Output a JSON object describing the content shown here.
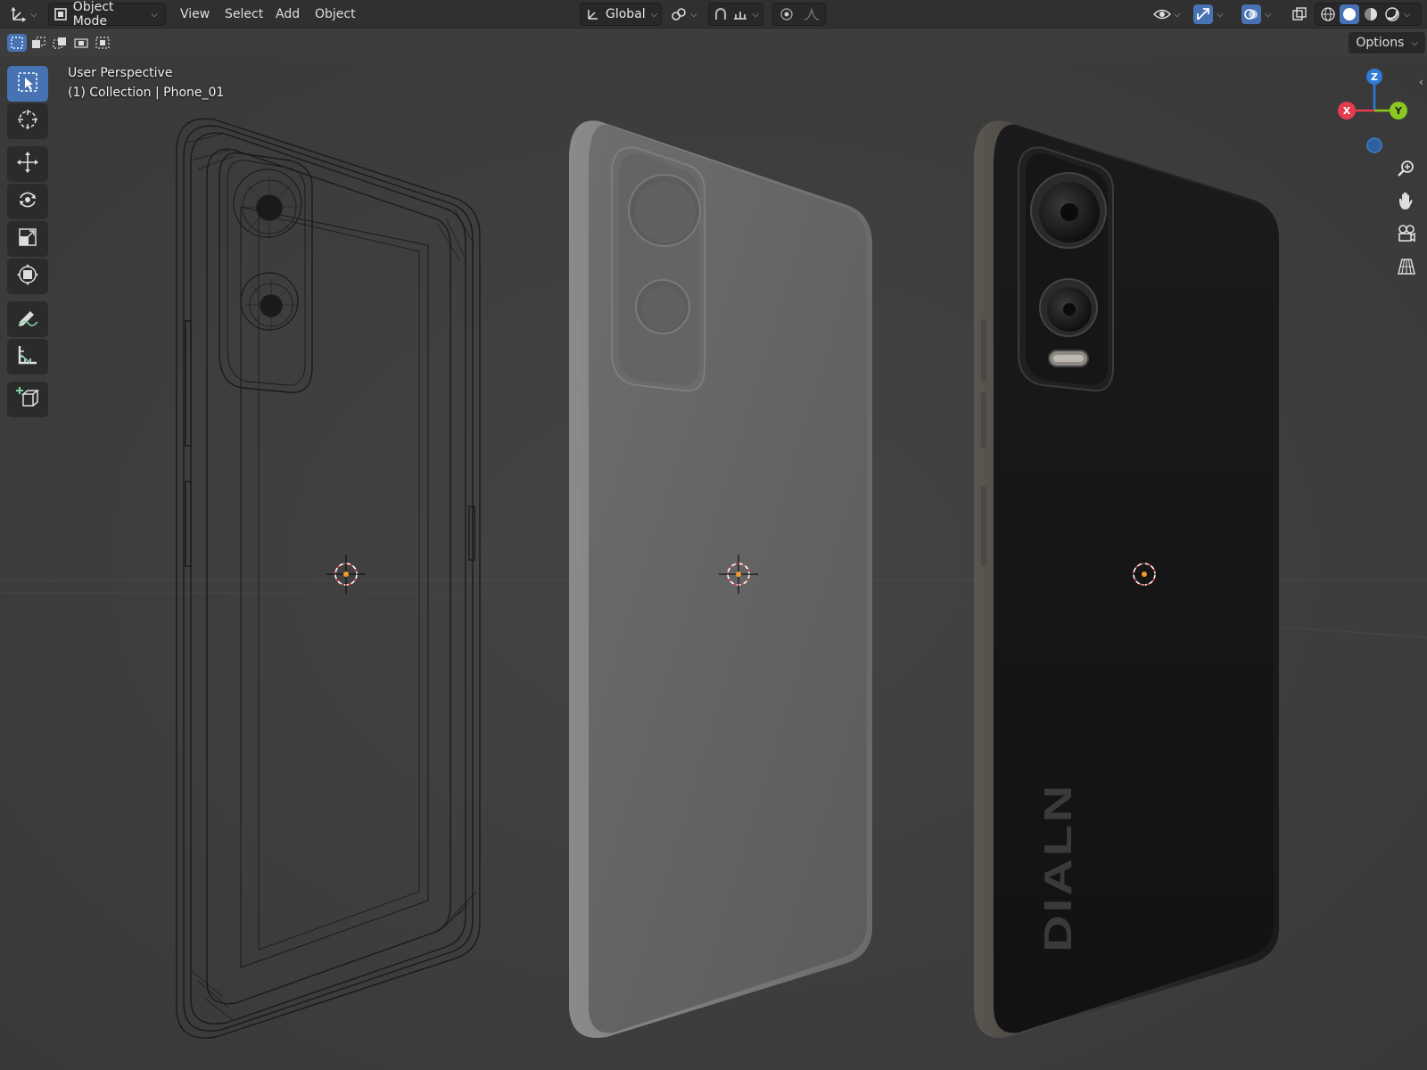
{
  "header": {
    "editor_icon": "grid-axes-icon",
    "mode_label": "Object Mode",
    "menus": [
      "View",
      "Select",
      "Add",
      "Object"
    ],
    "transform_orientation": "Global",
    "shading_modes": [
      "wireframe",
      "solid",
      "material-preview",
      "rendered"
    ],
    "active_shading": "solid"
  },
  "toolrow": {
    "selection_modes": [
      "new",
      "extend",
      "subtract",
      "invert",
      "intersect"
    ],
    "options_label": "Options"
  },
  "toolbar": {
    "tools": [
      "select-box",
      "cursor",
      "move",
      "rotate",
      "scale",
      "transform",
      "annotate",
      "measure",
      "add-cube"
    ],
    "active_tool": "select-box"
  },
  "viewport": {
    "view_name": "User Perspective",
    "collection_info": "(1) Collection | Phone_01",
    "back_logo": "DIALN"
  },
  "gizmo": {
    "axes": [
      "X",
      "Y",
      "Z"
    ]
  },
  "colors": {
    "accent": "#4772b3",
    "x_axis": "#e43c4f",
    "y_axis": "#8bc81f",
    "z_axis": "#2f7bd8",
    "background": "#3d3d3d",
    "header": "#303030"
  }
}
